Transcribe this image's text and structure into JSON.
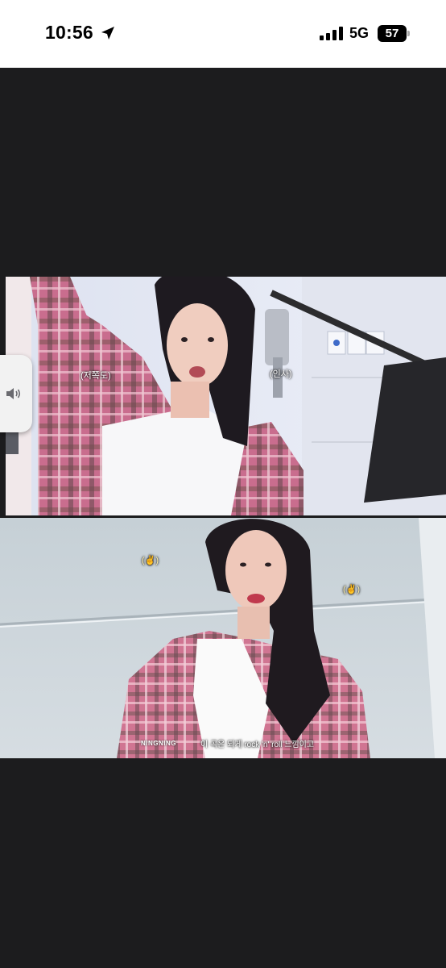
{
  "status_bar": {
    "time": "10:56",
    "location_icon": "location-arrow-icon",
    "signal_icon": "cellular-signal-icon",
    "network": "5G",
    "battery_level": "57",
    "battery_icon": "battery-icon"
  },
  "image_viewer": {
    "top_frame": {
      "caption_left": "(저쪽도)",
      "caption_right": "(인사)"
    },
    "bottom_frame": {
      "emoji_left": "(✌)",
      "emoji_right": "(✌)",
      "brand": "NINGNING",
      "subtitle": "이 곡은 되게 rock 'n' roll 느낌이고"
    },
    "volume_icon": "speaker-volume-icon"
  }
}
